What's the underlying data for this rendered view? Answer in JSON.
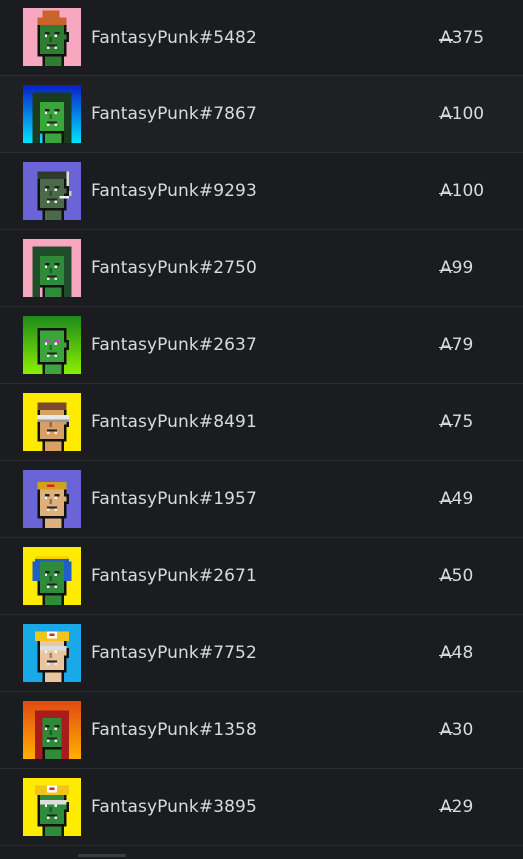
{
  "currency_symbol": "A",
  "items": [
    {
      "name": "FantasyPunk#5482",
      "price": "375",
      "bg": "#f7a8c0",
      "skin": "#2e7d32",
      "hair": "#c8642a",
      "style": "bun"
    },
    {
      "name": "FantasyPunk#7867",
      "price": "100",
      "bg_top": "#0a1fc8",
      "bg_bottom": "#00e5ff",
      "skin": "#3aa53a",
      "hair": "#1c3a1c",
      "style": "hood"
    },
    {
      "name": "FantasyPunk#9293",
      "price": "100",
      "bg": "#6a64d6",
      "skin": "#4a6a4a",
      "hair": "#2f3a2f",
      "style": "smoke"
    },
    {
      "name": "FantasyPunk#2750",
      "price": "99",
      "bg": "#f7a8c0",
      "skin": "#2e8b3a",
      "hair": "#1f4d2a",
      "style": "hood"
    },
    {
      "name": "FantasyPunk#2637",
      "price": "79",
      "bg_top": "#1b8a1b",
      "bg_bottom": "#8cf000",
      "skin": "#3aa53a",
      "hair": "#2a6b2a",
      "style": "plain"
    },
    {
      "name": "FantasyPunk#8491",
      "price": "75",
      "bg": "#ffeb00",
      "skin": "#d9a066",
      "hair": "#7a4a2a",
      "style": "visor"
    },
    {
      "name": "FantasyPunk#1957",
      "price": "49",
      "bg": "#6a64d6",
      "skin": "#e0b07a",
      "hair": "#d4a020",
      "style": "band"
    },
    {
      "name": "FantasyPunk#2671",
      "price": "50",
      "bg": "#ffeb00",
      "skin": "#2e8b3a",
      "hair": "#1e5fc8",
      "style": "headphones"
    },
    {
      "name": "FantasyPunk#7752",
      "price": "48",
      "bg": "#1aa9e8",
      "skin": "#e8c7a0",
      "hair": "#f0c419",
      "style": "cap"
    },
    {
      "name": "FantasyPunk#1358",
      "price": "30",
      "bg_top": "#e04a12",
      "bg_bottom": "#ffb000",
      "skin": "#2e8b3a",
      "hair": "#a81c1c",
      "style": "long"
    },
    {
      "name": "FantasyPunk#3895",
      "price": "29",
      "bg": "#ffeb00",
      "skin": "#2e8b3a",
      "hair": "#f0c419",
      "style": "cap"
    }
  ]
}
